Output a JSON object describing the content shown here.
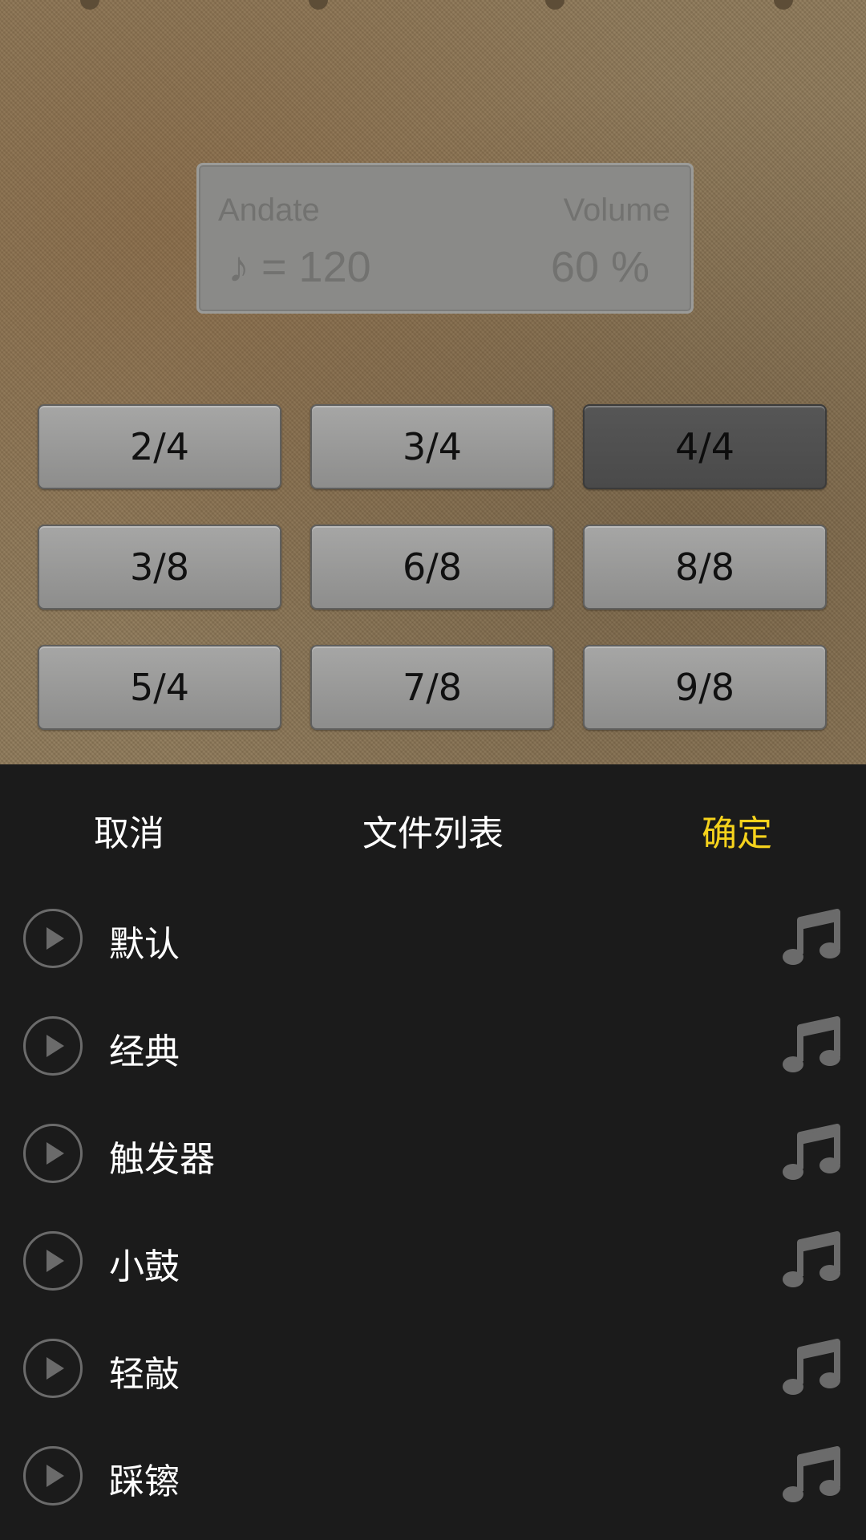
{
  "metronome": {
    "tempo_name": "Andate",
    "tempo_value": "♪ = 120",
    "volume_label": "Volume",
    "volume_value": "60 %",
    "signatures": [
      "2/4",
      "3/4",
      "4/4",
      "3/8",
      "6/8",
      "8/8",
      "5/4",
      "7/8",
      "9/8"
    ],
    "selected_signature": "4/4"
  },
  "sheet": {
    "cancel_label": "取消",
    "title": "文件列表",
    "confirm_label": "确定",
    "confirm_color": "#f5d21c",
    "items": [
      {
        "label": "默认",
        "play_icon": "play-icon",
        "note_icon": "music-note-icon"
      },
      {
        "label": "经典",
        "play_icon": "play-icon",
        "note_icon": "music-note-icon"
      },
      {
        "label": "触发器",
        "play_icon": "play-icon",
        "note_icon": "music-note-icon"
      },
      {
        "label": "小鼓",
        "play_icon": "play-icon",
        "note_icon": "music-note-icon"
      },
      {
        "label": "轻敲",
        "play_icon": "play-icon",
        "note_icon": "music-note-icon"
      },
      {
        "label": "踩镲",
        "play_icon": "play-icon",
        "note_icon": "music-note-icon"
      }
    ]
  }
}
